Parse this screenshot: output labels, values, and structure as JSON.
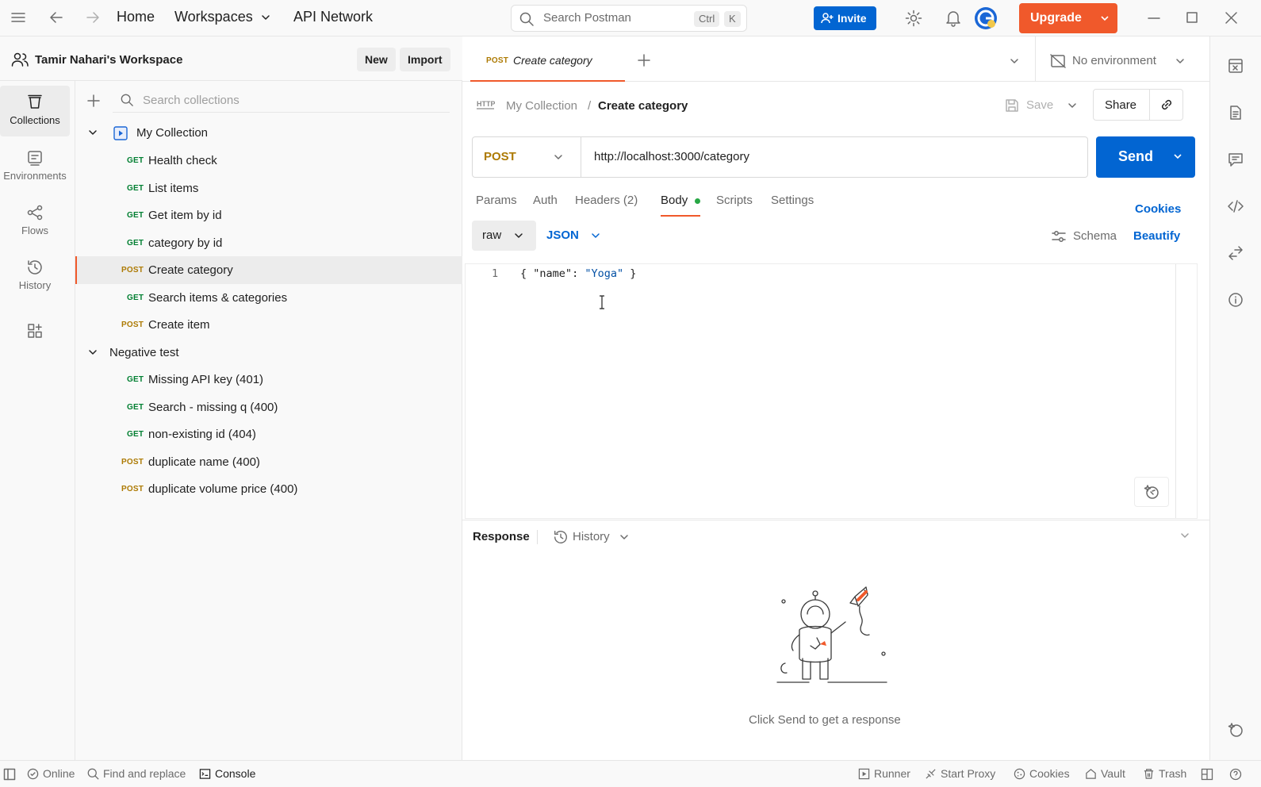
{
  "topbar": {
    "nav": [
      "Home",
      "Workspaces",
      "API Network"
    ],
    "search_placeholder": "Search Postman",
    "shortcut_mod": "Ctrl",
    "shortcut_key": "K",
    "invite_label": "Invite",
    "upgrade_label": "Upgrade"
  },
  "rail": [
    {
      "label": "Collections",
      "icon": "collections-icon"
    },
    {
      "label": "Environments",
      "icon": "environments-icon"
    },
    {
      "label": "Flows",
      "icon": "flows-icon"
    },
    {
      "label": "History",
      "icon": "history-icon"
    }
  ],
  "workspace": {
    "name": "Tamir Nahari's Workspace",
    "new_label": "New",
    "import_label": "Import",
    "search_placeholder": "Search collections"
  },
  "tree": {
    "collection_name": "My Collection",
    "items": [
      {
        "method": "GET",
        "name": "Health check"
      },
      {
        "method": "GET",
        "name": "List items"
      },
      {
        "method": "GET",
        "name": "Get item by id"
      },
      {
        "method": "GET",
        "name": "category by id"
      },
      {
        "method": "POST",
        "name": "Create category"
      },
      {
        "method": "GET",
        "name": "Search items & categories"
      },
      {
        "method": "POST",
        "name": "Create item"
      }
    ],
    "folder_name": "Negative test",
    "folder_items": [
      {
        "method": "GET",
        "name": "Missing API key (401)"
      },
      {
        "method": "GET",
        "name": "Search - missing q (400)"
      },
      {
        "method": "GET",
        "name": "non-existing id (404)"
      },
      {
        "method": "POST",
        "name": "duplicate name (400)"
      },
      {
        "method": "POST",
        "name": "duplicate volume price (400)"
      }
    ]
  },
  "tab": {
    "method": "POST",
    "name": "Create category",
    "environment": "No environment"
  },
  "request": {
    "breadcrumb_collection": "My Collection",
    "breadcrumb_sep": "/",
    "title": "Create category",
    "save_label": "Save",
    "share_label": "Share",
    "method": "POST",
    "url": "http://localhost:3000/category",
    "send_label": "Send",
    "tabs": [
      "Params",
      "Auth",
      "Headers (2)",
      "Body",
      "Scripts",
      "Settings"
    ],
    "cookies_label": "Cookies",
    "body_mode": "raw",
    "body_lang": "JSON",
    "schema_label": "Schema",
    "beautify_label": "Beautify",
    "line_no": "1",
    "code_open": "{",
    "code_key": "\"name\"",
    "code_colon": ":",
    "code_value": "\"Yoga\"",
    "code_close": "}"
  },
  "response": {
    "title": "Response",
    "history_label": "History",
    "empty_text": "Click Send to get a response"
  },
  "status": {
    "online": "Online",
    "find_replace": "Find and replace",
    "console": "Console",
    "runner": "Runner",
    "proxy": "Start Proxy",
    "cookies": "Cookies",
    "vault": "Vault",
    "trash": "Trash"
  },
  "colors": {
    "accent": "#f0592b",
    "primary": "#0265d2",
    "get": "#007f31",
    "post": "#ad7a03"
  }
}
